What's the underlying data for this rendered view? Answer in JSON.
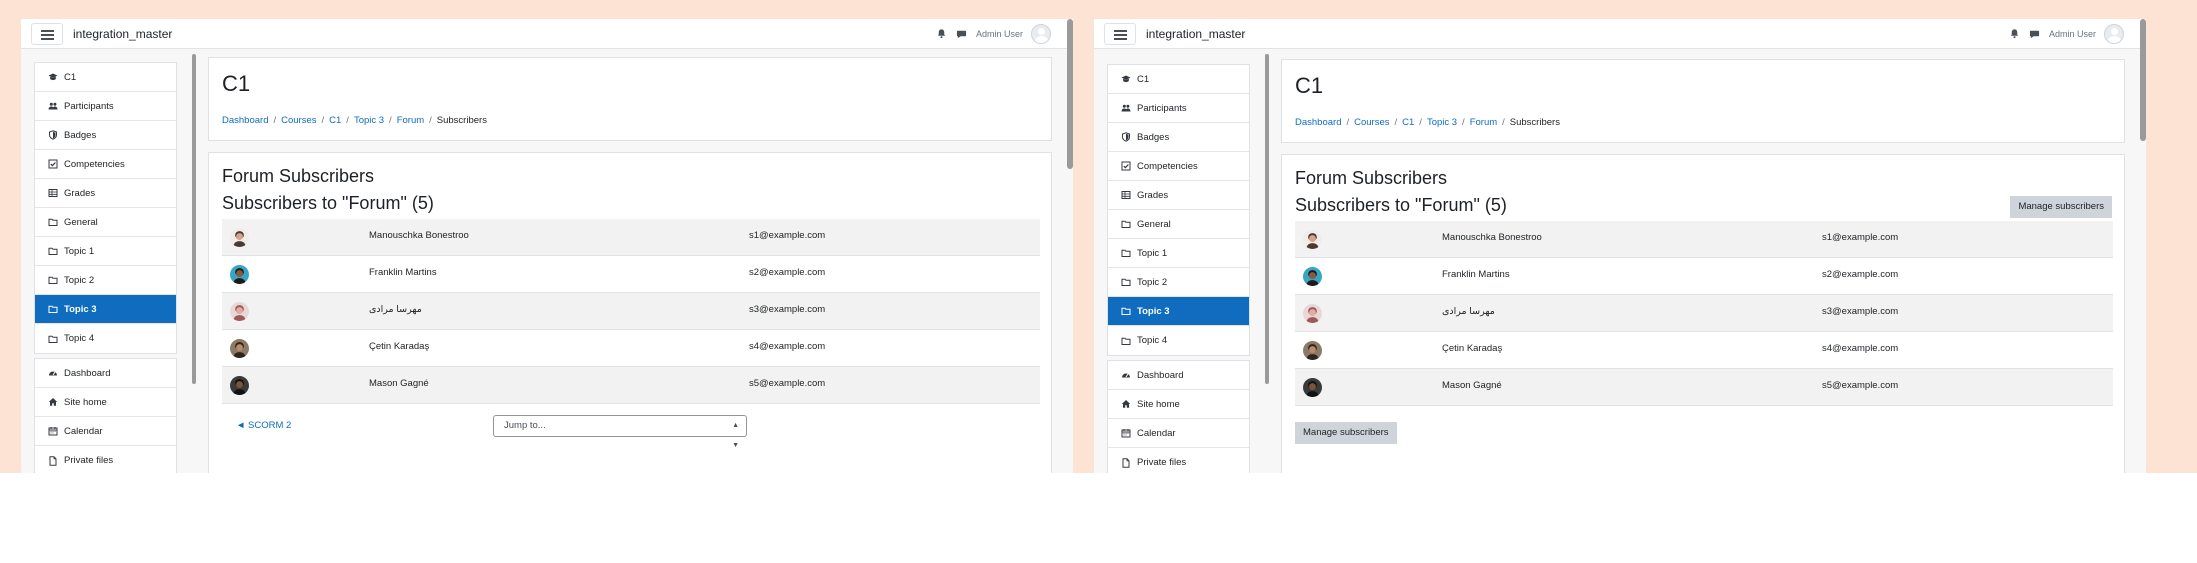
{
  "app": {
    "site_name": "integration_master",
    "user_name": "Admin User"
  },
  "drawer": {
    "course_items": [
      {
        "label": "C1",
        "icon": "graduation-cap-icon"
      },
      {
        "label": "Participants",
        "icon": "users-icon"
      },
      {
        "label": "Badges",
        "icon": "shield-icon"
      },
      {
        "label": "Competencies",
        "icon": "check-square-icon"
      },
      {
        "label": "Grades",
        "icon": "table-icon"
      },
      {
        "label": "General",
        "icon": "folder-icon"
      },
      {
        "label": "Topic 1",
        "icon": "folder-icon"
      },
      {
        "label": "Topic 2",
        "icon": "folder-icon"
      },
      {
        "label": "Topic 3",
        "icon": "folder-icon",
        "active": true
      },
      {
        "label": "Topic 4",
        "icon": "folder-icon"
      }
    ],
    "site_items": [
      {
        "label": "Dashboard",
        "icon": "tachometer-icon"
      },
      {
        "label": "Site home",
        "icon": "home-icon"
      },
      {
        "label": "Calendar",
        "icon": "calendar-icon"
      },
      {
        "label": "Private files",
        "icon": "file-icon"
      }
    ]
  },
  "header": {
    "title": "C1",
    "breadcrumb": [
      "Dashboard",
      "Courses",
      "C1",
      "Topic 3",
      "Forum",
      "Subscribers"
    ]
  },
  "content": {
    "heading": "Forum Subscribers",
    "subheading": "Subscribers to \"Forum\" (5)",
    "manage_label": "Manage subscribers",
    "subscribers": [
      {
        "name": "Manouschka Bonestroo",
        "email": "s1@example.com"
      },
      {
        "name": "Franklin Martins",
        "email": "s2@example.com"
      },
      {
        "name": "مهرسا مرادی",
        "email": "s3@example.com"
      },
      {
        "name": "Çetin Karadaş",
        "email": "s4@example.com"
      },
      {
        "name": "Mason Gagné",
        "email": "s5@example.com"
      }
    ],
    "prev_activity": "◄ SCORM 2",
    "jump_placeholder": "Jump to..."
  },
  "colors": {
    "accent": "#0f6cbf",
    "page_bg": "#fde3d3",
    "button_bg": "#ced4da"
  }
}
